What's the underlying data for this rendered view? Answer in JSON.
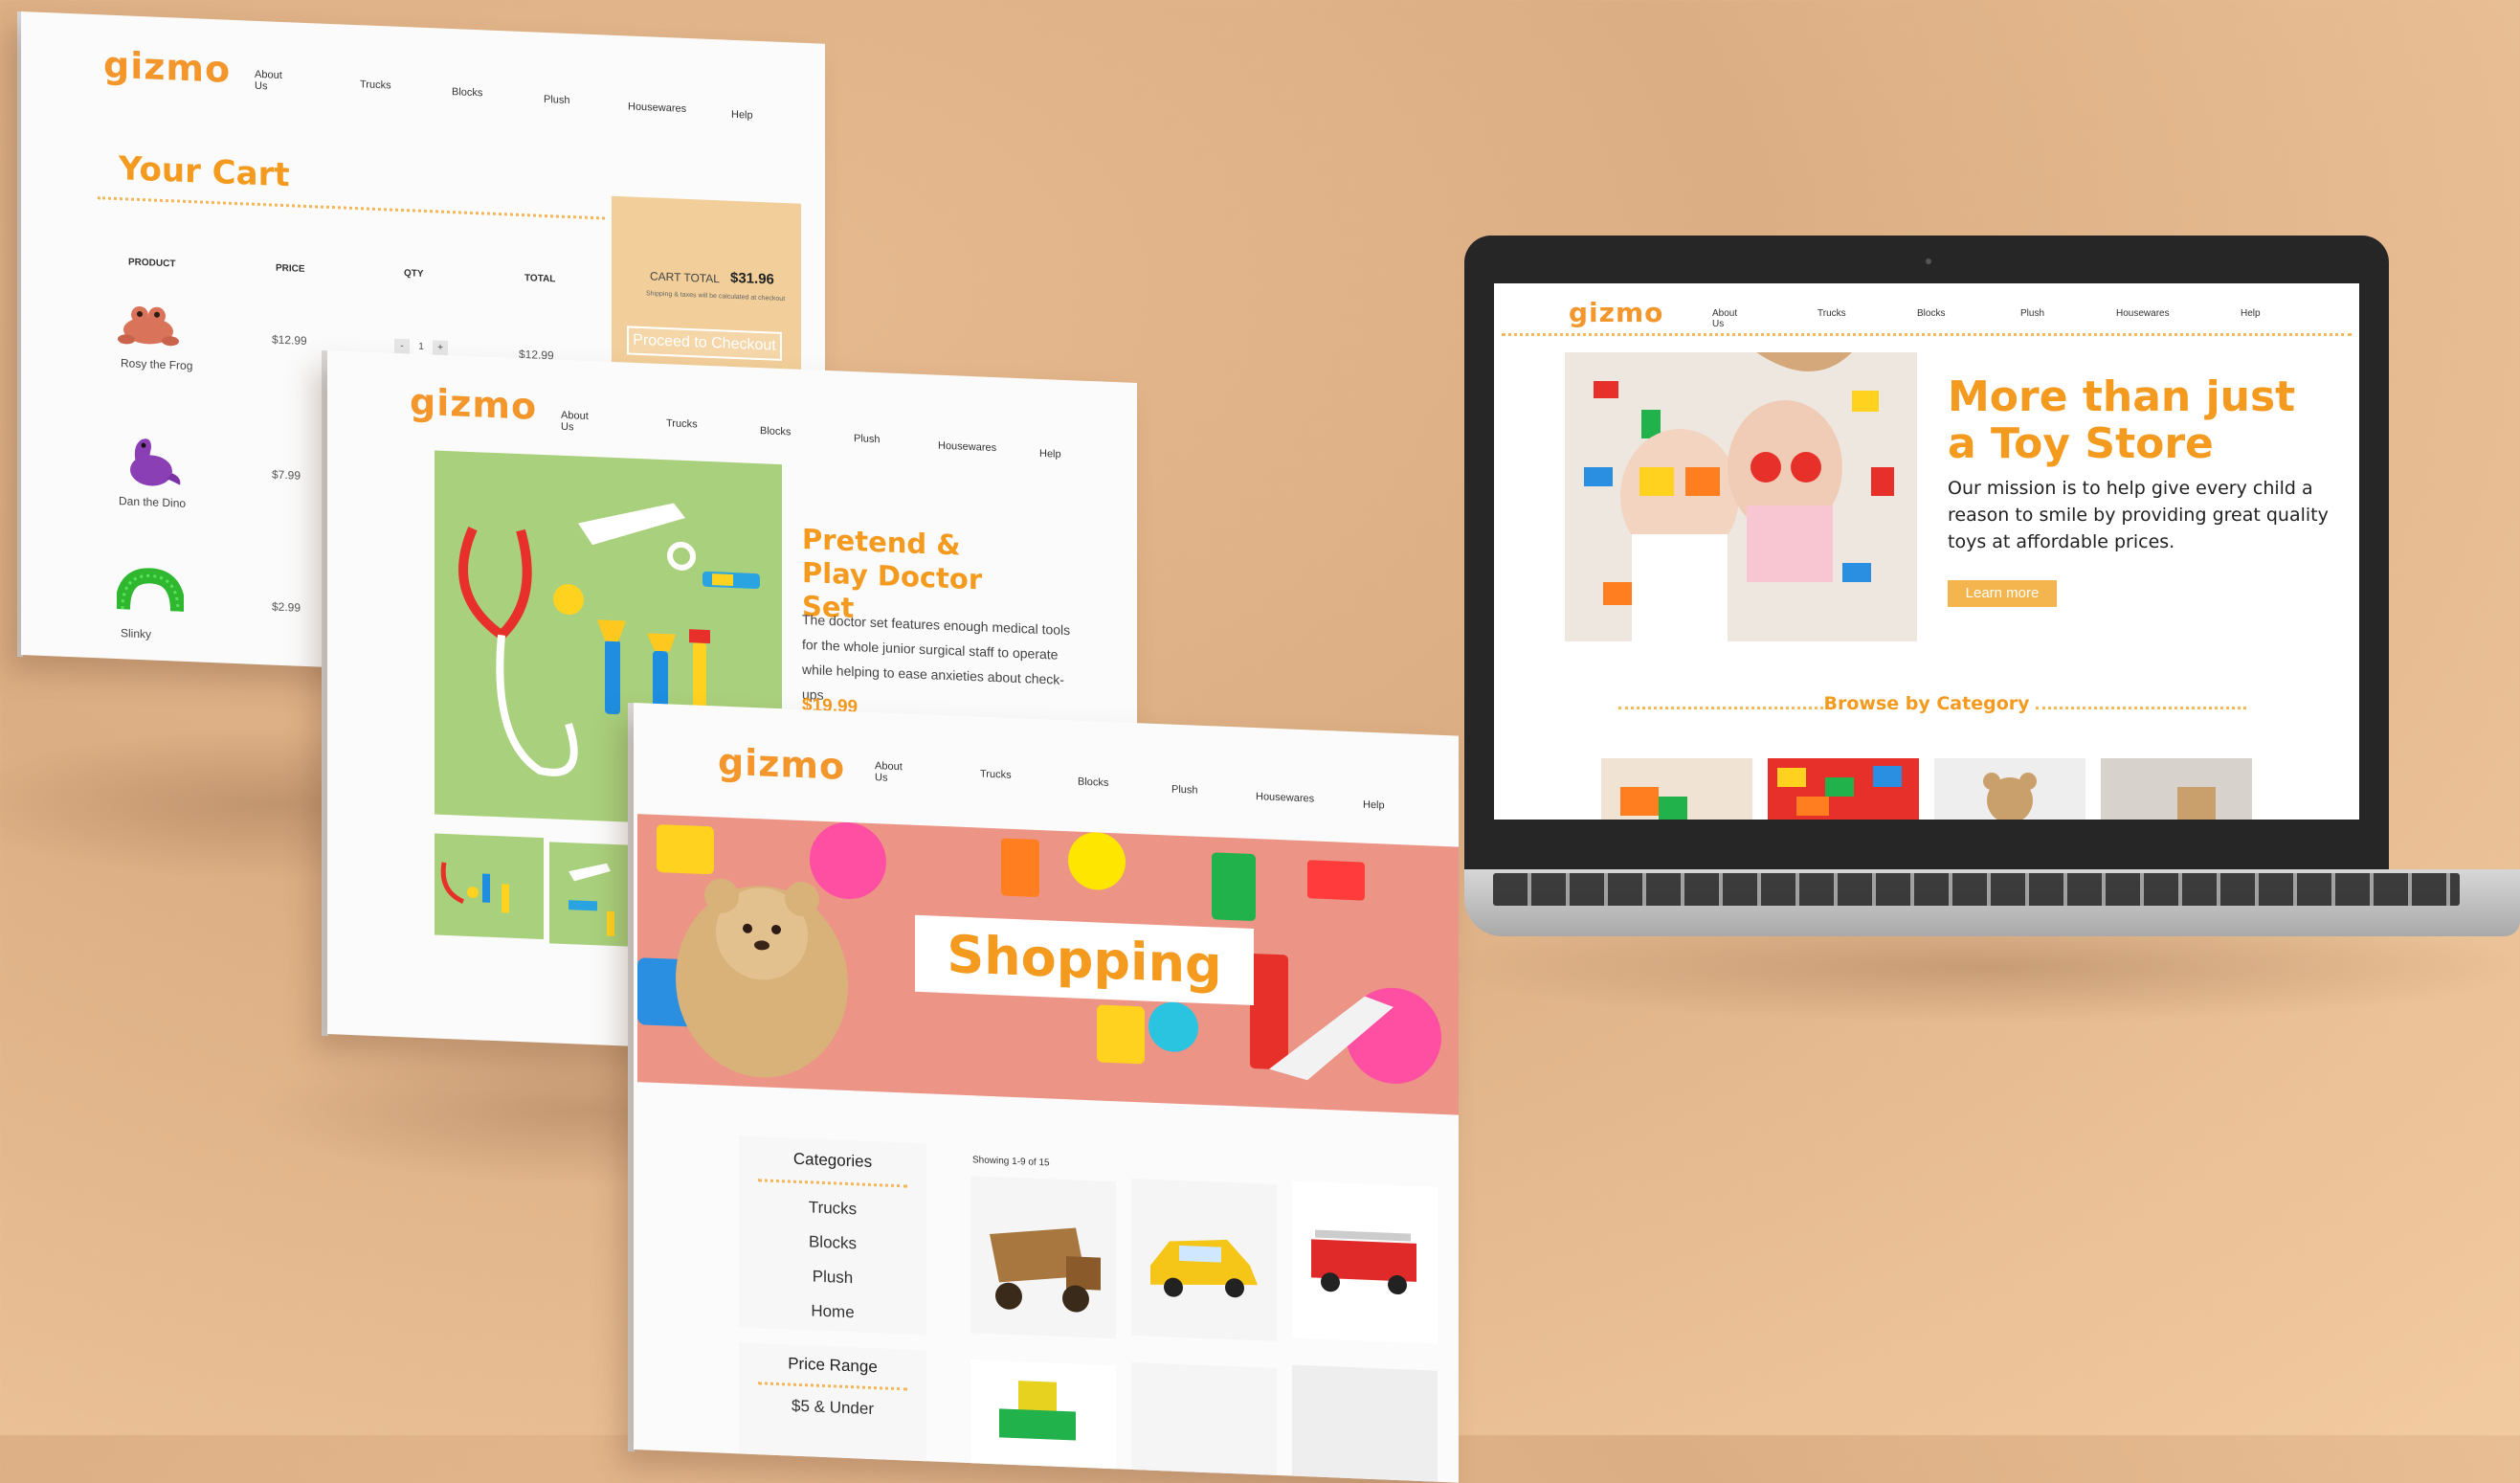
{
  "brand": {
    "logo": "gizmo",
    "accent": "#f39a1f"
  },
  "nav": [
    "About Us",
    "Trucks",
    "Blocks",
    "Plush",
    "Housewares",
    "Help"
  ],
  "cart_page": {
    "title": "Your Cart",
    "headers": {
      "product": "PRODUCT",
      "price": "PRICE",
      "qty": "QTY",
      "total": "TOTAL"
    },
    "items": [
      {
        "name": "Rosy the Frog",
        "price": "$12.99",
        "qty": "1",
        "total": "$12.99",
        "qty_minus": "-",
        "qty_plus": "+"
      },
      {
        "name": "Dan the Dino",
        "price": "$7.99"
      },
      {
        "name": "Slinky",
        "price": "$2.99"
      }
    ],
    "summary": {
      "label": "CART TOTAL",
      "total": "$31.96",
      "note": "Shipping & taxes will be calculated at checkout",
      "button": "Proceed to Checkout"
    }
  },
  "product_page": {
    "title": "Pretend & Play Doctor Set",
    "description": "The doctor set features enough medical tools for the whole junior surgical staff to operate while helping to ease anxieties about check-ups",
    "price": "$19.99"
  },
  "shop_page": {
    "hero_label": "Shopping",
    "categories_title": "Categories",
    "categories": [
      "Trucks",
      "Blocks",
      "Plush",
      "Home"
    ],
    "active_category": "Trucks",
    "price_title": "Price Range",
    "price_ranges": [
      "$5 & Under"
    ],
    "showing": "Showing 1-9 of 15"
  },
  "home_page": {
    "headline": "More than just a Toy Store",
    "mission": "Our mission is to help give every child a reason to smile by providing great quality toys at affordable prices.",
    "cta": "Learn more",
    "browse": "Browse by Category"
  }
}
